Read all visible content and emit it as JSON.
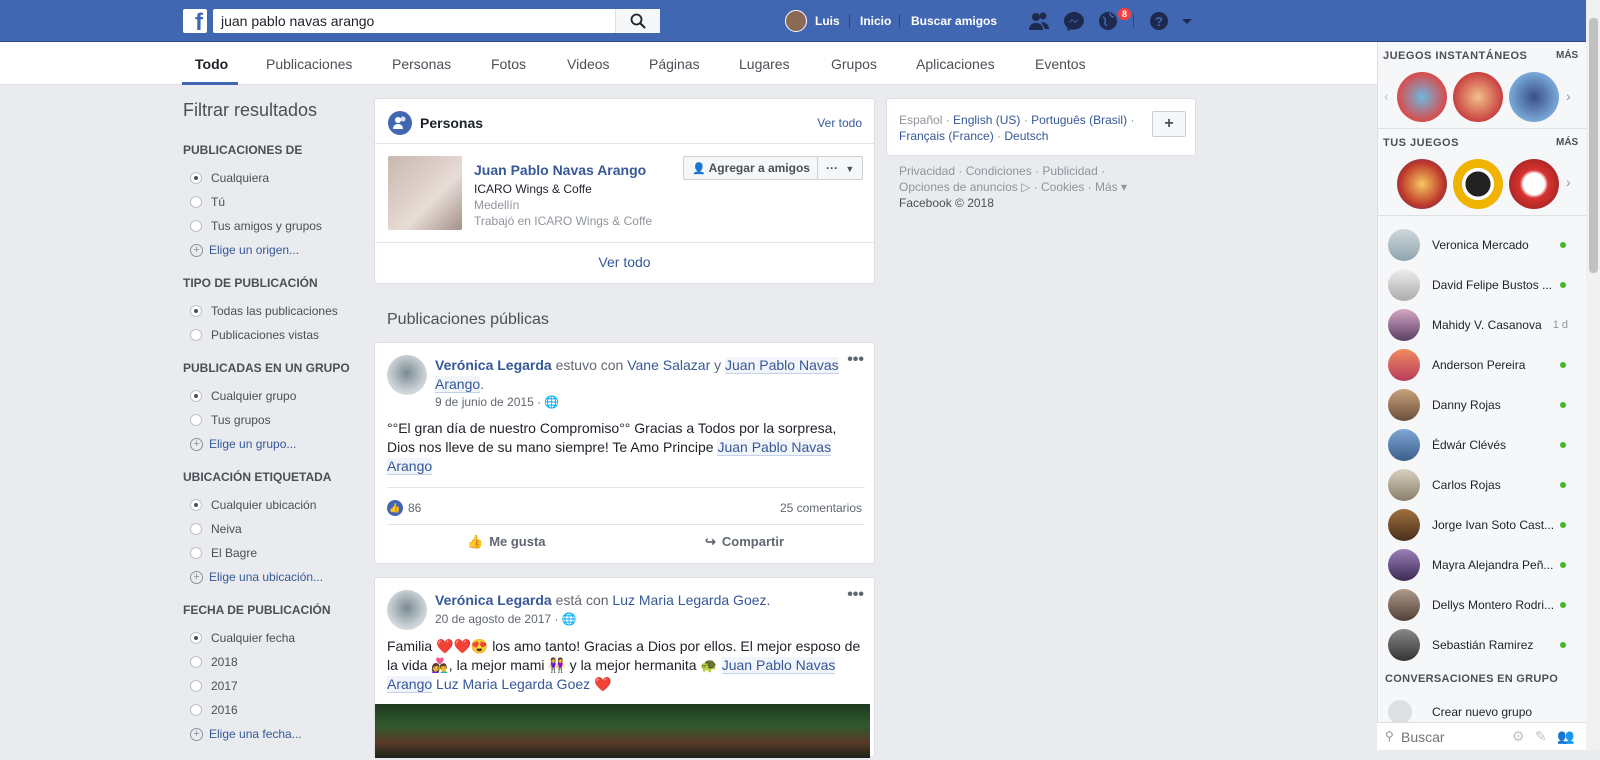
{
  "header": {
    "search_value": "juan pablo navas arango",
    "user_name": "Luis",
    "home_label": "Inicio",
    "find_friends_label": "Buscar amigos",
    "notifications_count": "8"
  },
  "tabs": [
    "Todo",
    "Publicaciones",
    "Personas",
    "Fotos",
    "Videos",
    "Páginas",
    "Lugares",
    "Grupos",
    "Aplicaciones",
    "Eventos"
  ],
  "filters": {
    "title": "Filtrar resultados",
    "groups": [
      {
        "heading": "PUBLICACIONES DE",
        "options": [
          "Cualquiera",
          "Tú",
          "Tus amigos y grupos"
        ],
        "link": "Elige un origen..."
      },
      {
        "heading": "TIPO DE PUBLICACIÓN",
        "options": [
          "Todas las publicaciones",
          "Publicaciones vistas"
        ],
        "link": ""
      },
      {
        "heading": "PUBLICADAS EN UN GRUPO",
        "options": [
          "Cualquier grupo",
          "Tus grupos"
        ],
        "link": "Elige un grupo..."
      },
      {
        "heading": "UBICACIÓN ETIQUETADA",
        "options": [
          "Cualquier ubicación",
          "Neiva",
          "El Bagre"
        ],
        "link": "Elige una ubicación..."
      },
      {
        "heading": "FECHA DE PUBLICACIÓN",
        "options": [
          "Cualquier fecha",
          "2018",
          "2017",
          "2016"
        ],
        "link": "Elige una fecha..."
      }
    ]
  },
  "people": {
    "title": "Personas",
    "see_all_top": "Ver todo",
    "name": "Juan Pablo Navas Arango",
    "line1": "ICARO Wings & Coffe",
    "line2": "Medellín",
    "line3": "Trabajó en ICARO Wings & Coffe",
    "add_friend": "Agregar a amigos",
    "more": "···",
    "see_all_bottom": "Ver todo"
  },
  "public_posts_title": "Publicaciones públicas",
  "post1": {
    "author": "Verónica Legarda",
    "with_text": " estuvo con ",
    "tag1": "Vane Salazar",
    "and": " y ",
    "tag2": "Juan Pablo Navas Arango",
    "date": "9 de junio de 2015 · ",
    "body": "°°El gran día de nuestro Compromiso°° Gracias a Todos por la sorpresa, Dios nos lleve de su mano siempre! Te Amo Principe ",
    "body_link": "Juan Pablo Navas Arango",
    "likes": "86",
    "comments": "25 comentarios",
    "like_btn": "Me gusta",
    "share_btn": "Compartir"
  },
  "post2": {
    "author": "Verónica Legarda",
    "with_text": " está con ",
    "tag1": "Luz Maria Legarda Goez.",
    "date": "20 de agosto de 2017 · ",
    "body_a": "Familia ❤️❤️😍 los amo tanto! Gracias a Dios por ellos. El mejor esposo de la vida 👩‍❤️‍👨, la mejor mami 👭 y la mejor hermanita 🐢 ",
    "body_link1": "Juan Pablo Navas Arango",
    "body_link2": "Luz Maria Legarda Goez",
    "body_end": " ❤️"
  },
  "languages": {
    "current": "Español · ",
    "others": [
      "English (US)",
      "Português (Brasil)",
      "Français (France)",
      "Deutsch"
    ],
    "plus": "+"
  },
  "footer_links": {
    "line1": "Privacidad · Condiciones · Publicidad ·",
    "line2": "Opciones de anuncios ▷ · Cookies · Más ▾",
    "copyright": "Facebook © 2018"
  },
  "sidebar": {
    "instant_games": "JUEGOS INSTANTÁNEOS",
    "more1": "MÁS",
    "your_games": "TUS JUEGOS",
    "more2": "MÁS",
    "contacts": [
      {
        "name": "Veronica Mercado",
        "status": "online"
      },
      {
        "name": "David Felipe Bustos ...",
        "status": "online"
      },
      {
        "name": "Mahidy V. Casanova",
        "status": "1 d"
      },
      {
        "name": "Anderson Pereira",
        "status": "online"
      },
      {
        "name": "Danny Rojas",
        "status": "online"
      },
      {
        "name": "Édwár Clévés",
        "status": "online"
      },
      {
        "name": "Carlos Rojas",
        "status": "online"
      },
      {
        "name": "Jorge Ivan Soto Cast...",
        "status": "online"
      },
      {
        "name": "Mayra Alejandra Peñ...",
        "status": "online"
      },
      {
        "name": "Dellys Montero Rodri...",
        "status": "online"
      },
      {
        "name": "Sebastián Ramirez",
        "status": "online"
      }
    ],
    "group_convos": "CONVERSACIONES EN GRUPO",
    "create_group": "Crear nuevo grupo",
    "search_placeholder": "Buscar"
  }
}
